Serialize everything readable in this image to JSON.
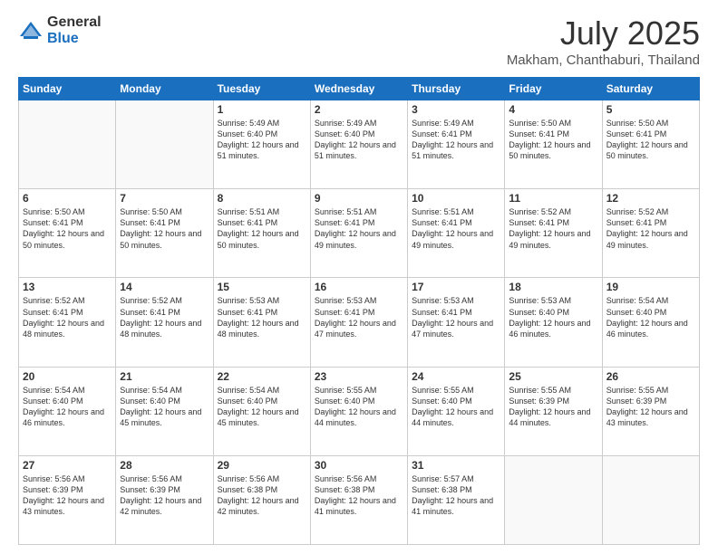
{
  "logo": {
    "general": "General",
    "blue": "Blue"
  },
  "title": "July 2025",
  "location": "Makham, Chanthaburi, Thailand",
  "weekdays": [
    "Sunday",
    "Monday",
    "Tuesday",
    "Wednesday",
    "Thursday",
    "Friday",
    "Saturday"
  ],
  "weeks": [
    [
      {
        "day": "",
        "sunrise": "",
        "sunset": "",
        "daylight": ""
      },
      {
        "day": "",
        "sunrise": "",
        "sunset": "",
        "daylight": ""
      },
      {
        "day": "1",
        "sunrise": "Sunrise: 5:49 AM",
        "sunset": "Sunset: 6:40 PM",
        "daylight": "Daylight: 12 hours and 51 minutes."
      },
      {
        "day": "2",
        "sunrise": "Sunrise: 5:49 AM",
        "sunset": "Sunset: 6:40 PM",
        "daylight": "Daylight: 12 hours and 51 minutes."
      },
      {
        "day": "3",
        "sunrise": "Sunrise: 5:49 AM",
        "sunset": "Sunset: 6:41 PM",
        "daylight": "Daylight: 12 hours and 51 minutes."
      },
      {
        "day": "4",
        "sunrise": "Sunrise: 5:50 AM",
        "sunset": "Sunset: 6:41 PM",
        "daylight": "Daylight: 12 hours and 50 minutes."
      },
      {
        "day": "5",
        "sunrise": "Sunrise: 5:50 AM",
        "sunset": "Sunset: 6:41 PM",
        "daylight": "Daylight: 12 hours and 50 minutes."
      }
    ],
    [
      {
        "day": "6",
        "sunrise": "Sunrise: 5:50 AM",
        "sunset": "Sunset: 6:41 PM",
        "daylight": "Daylight: 12 hours and 50 minutes."
      },
      {
        "day": "7",
        "sunrise": "Sunrise: 5:50 AM",
        "sunset": "Sunset: 6:41 PM",
        "daylight": "Daylight: 12 hours and 50 minutes."
      },
      {
        "day": "8",
        "sunrise": "Sunrise: 5:51 AM",
        "sunset": "Sunset: 6:41 PM",
        "daylight": "Daylight: 12 hours and 50 minutes."
      },
      {
        "day": "9",
        "sunrise": "Sunrise: 5:51 AM",
        "sunset": "Sunset: 6:41 PM",
        "daylight": "Daylight: 12 hours and 49 minutes."
      },
      {
        "day": "10",
        "sunrise": "Sunrise: 5:51 AM",
        "sunset": "Sunset: 6:41 PM",
        "daylight": "Daylight: 12 hours and 49 minutes."
      },
      {
        "day": "11",
        "sunrise": "Sunrise: 5:52 AM",
        "sunset": "Sunset: 6:41 PM",
        "daylight": "Daylight: 12 hours and 49 minutes."
      },
      {
        "day": "12",
        "sunrise": "Sunrise: 5:52 AM",
        "sunset": "Sunset: 6:41 PM",
        "daylight": "Daylight: 12 hours and 49 minutes."
      }
    ],
    [
      {
        "day": "13",
        "sunrise": "Sunrise: 5:52 AM",
        "sunset": "Sunset: 6:41 PM",
        "daylight": "Daylight: 12 hours and 48 minutes."
      },
      {
        "day": "14",
        "sunrise": "Sunrise: 5:52 AM",
        "sunset": "Sunset: 6:41 PM",
        "daylight": "Daylight: 12 hours and 48 minutes."
      },
      {
        "day": "15",
        "sunrise": "Sunrise: 5:53 AM",
        "sunset": "Sunset: 6:41 PM",
        "daylight": "Daylight: 12 hours and 48 minutes."
      },
      {
        "day": "16",
        "sunrise": "Sunrise: 5:53 AM",
        "sunset": "Sunset: 6:41 PM",
        "daylight": "Daylight: 12 hours and 47 minutes."
      },
      {
        "day": "17",
        "sunrise": "Sunrise: 5:53 AM",
        "sunset": "Sunset: 6:41 PM",
        "daylight": "Daylight: 12 hours and 47 minutes."
      },
      {
        "day": "18",
        "sunrise": "Sunrise: 5:53 AM",
        "sunset": "Sunset: 6:40 PM",
        "daylight": "Daylight: 12 hours and 46 minutes."
      },
      {
        "day": "19",
        "sunrise": "Sunrise: 5:54 AM",
        "sunset": "Sunset: 6:40 PM",
        "daylight": "Daylight: 12 hours and 46 minutes."
      }
    ],
    [
      {
        "day": "20",
        "sunrise": "Sunrise: 5:54 AM",
        "sunset": "Sunset: 6:40 PM",
        "daylight": "Daylight: 12 hours and 46 minutes."
      },
      {
        "day": "21",
        "sunrise": "Sunrise: 5:54 AM",
        "sunset": "Sunset: 6:40 PM",
        "daylight": "Daylight: 12 hours and 45 minutes."
      },
      {
        "day": "22",
        "sunrise": "Sunrise: 5:54 AM",
        "sunset": "Sunset: 6:40 PM",
        "daylight": "Daylight: 12 hours and 45 minutes."
      },
      {
        "day": "23",
        "sunrise": "Sunrise: 5:55 AM",
        "sunset": "Sunset: 6:40 PM",
        "daylight": "Daylight: 12 hours and 44 minutes."
      },
      {
        "day": "24",
        "sunrise": "Sunrise: 5:55 AM",
        "sunset": "Sunset: 6:40 PM",
        "daylight": "Daylight: 12 hours and 44 minutes."
      },
      {
        "day": "25",
        "sunrise": "Sunrise: 5:55 AM",
        "sunset": "Sunset: 6:39 PM",
        "daylight": "Daylight: 12 hours and 44 minutes."
      },
      {
        "day": "26",
        "sunrise": "Sunrise: 5:55 AM",
        "sunset": "Sunset: 6:39 PM",
        "daylight": "Daylight: 12 hours and 43 minutes."
      }
    ],
    [
      {
        "day": "27",
        "sunrise": "Sunrise: 5:56 AM",
        "sunset": "Sunset: 6:39 PM",
        "daylight": "Daylight: 12 hours and 43 minutes."
      },
      {
        "day": "28",
        "sunrise": "Sunrise: 5:56 AM",
        "sunset": "Sunset: 6:39 PM",
        "daylight": "Daylight: 12 hours and 42 minutes."
      },
      {
        "day": "29",
        "sunrise": "Sunrise: 5:56 AM",
        "sunset": "Sunset: 6:38 PM",
        "daylight": "Daylight: 12 hours and 42 minutes."
      },
      {
        "day": "30",
        "sunrise": "Sunrise: 5:56 AM",
        "sunset": "Sunset: 6:38 PM",
        "daylight": "Daylight: 12 hours and 41 minutes."
      },
      {
        "day": "31",
        "sunrise": "Sunrise: 5:57 AM",
        "sunset": "Sunset: 6:38 PM",
        "daylight": "Daylight: 12 hours and 41 minutes."
      },
      {
        "day": "",
        "sunrise": "",
        "sunset": "",
        "daylight": ""
      },
      {
        "day": "",
        "sunrise": "",
        "sunset": "",
        "daylight": ""
      }
    ]
  ]
}
